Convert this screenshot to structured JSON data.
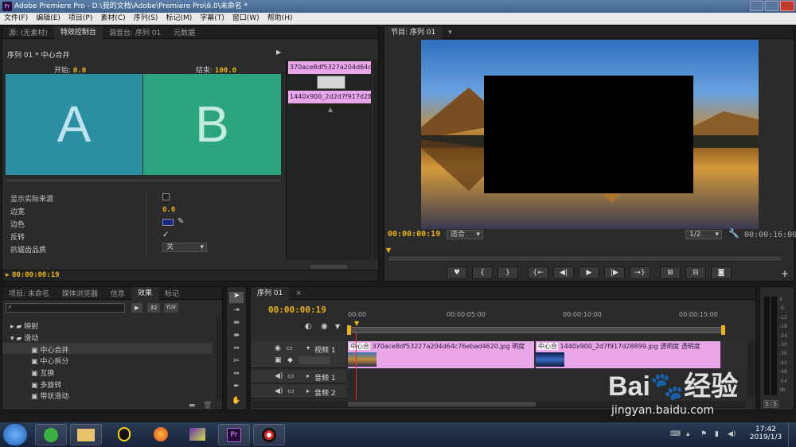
{
  "window": {
    "title": "Adobe Premiere Pro - D:\\我的文档\\Adobe\\Premiere Pro\\6.0\\未命名 *",
    "app_icon": "Pr"
  },
  "menu": [
    "文件(F)",
    "编辑(E)",
    "项目(P)",
    "素材(C)",
    "序列(S)",
    "标记(M)",
    "字幕(T)",
    "窗口(W)",
    "帮助(H)"
  ],
  "top_left_tabs": [
    "源: (无素材)",
    "特效控制台",
    "调音台: 序列 01",
    "元数据"
  ],
  "effects_control": {
    "header": "序列 01 * 中心合并",
    "start_label": "开始:",
    "start_value": "0.0",
    "end_label": "结束:",
    "end_value": "100.0",
    "preview_a": "A",
    "preview_b": "B",
    "mini_clip1": "370ace8df532",
    "mini_clip1b": "7a204d64c7",
    "mini_clip2": "1440x900_2d",
    "mini_clip2b": "2d7f917d2889",
    "props": [
      {
        "label": "显示实际来源",
        "value": ""
      },
      {
        "label": "边宽",
        "value": "0.0"
      },
      {
        "label": "边色",
        "value": ""
      },
      {
        "label": "反转",
        "value": "✓"
      },
      {
        "label": "抗锯齿品质",
        "value": "关"
      }
    ],
    "timecode": "00:00:00:19"
  },
  "program": {
    "tab": "节目: 序列 01",
    "timecode": "00:00:00:19",
    "fit": "适合",
    "resolution": "1/2",
    "duration": "00:00:16:00",
    "transport": [
      "♥",
      "{",
      "}",
      "{←",
      "◀|",
      "▶",
      "|▶",
      "→}",
      "⊞",
      "⊟",
      "◙"
    ]
  },
  "project_tabs": [
    "项目: 未命名",
    "媒体浏览器",
    "信息",
    "效果",
    "标记"
  ],
  "project_badges": [
    "32",
    "YUV"
  ],
  "effects_tree": [
    {
      "label": "映射",
      "level": 1,
      "type": "folder"
    },
    {
      "label": "滑动",
      "level": 1,
      "type": "folder-open"
    },
    {
      "label": "中心合并",
      "level": 2,
      "type": "effect",
      "selected": true
    },
    {
      "label": "中心拆分",
      "level": 2,
      "type": "effect"
    },
    {
      "label": "互换",
      "level": 2,
      "type": "effect"
    },
    {
      "label": "多旋转",
      "level": 2,
      "type": "effect"
    },
    {
      "label": "带状滑动",
      "level": 2,
      "type": "effect"
    }
  ],
  "timeline": {
    "tab": "序列 01",
    "timecode": "00:00:00:19",
    "ruler": [
      "00:00",
      "00:00:05:00",
      "00:00:10:00",
      "00:00:15:00"
    ],
    "tracks": [
      {
        "label": "视频 1",
        "kind": "video"
      },
      {
        "label": "音频 1",
        "kind": "audio"
      },
      {
        "label": "音频 2",
        "kind": "audio"
      }
    ],
    "clip1_transition": "中心合",
    "clip1_name": "370ace8df53227a204d64c76ebad4620.jpg",
    "clip1_tail": "明度",
    "clip2_transition": "中心合",
    "clip2_name": "1440x900_2d7f917d28899.jpg",
    "clip2_tail1": "透明度",
    "clip2_tail2": "透明度"
  },
  "meter": {
    "labels": [
      "0",
      "-6",
      "-12",
      "-18",
      "-24",
      "-30",
      "-36",
      "-42",
      "-48",
      "-54",
      "dB"
    ],
    "solo": [
      "S",
      "S"
    ]
  },
  "watermark": {
    "brand": "Bai",
    "brand_mid": "经验",
    "url": "jingyan.baidu.com"
  },
  "tray": {
    "time": "17:42",
    "date": "2019/1/3"
  },
  "colors": {
    "accent": "#e8b31b",
    "clip": "#e9a6e9",
    "tealA": "#2c8ea3",
    "greenB": "#2aa57f"
  }
}
